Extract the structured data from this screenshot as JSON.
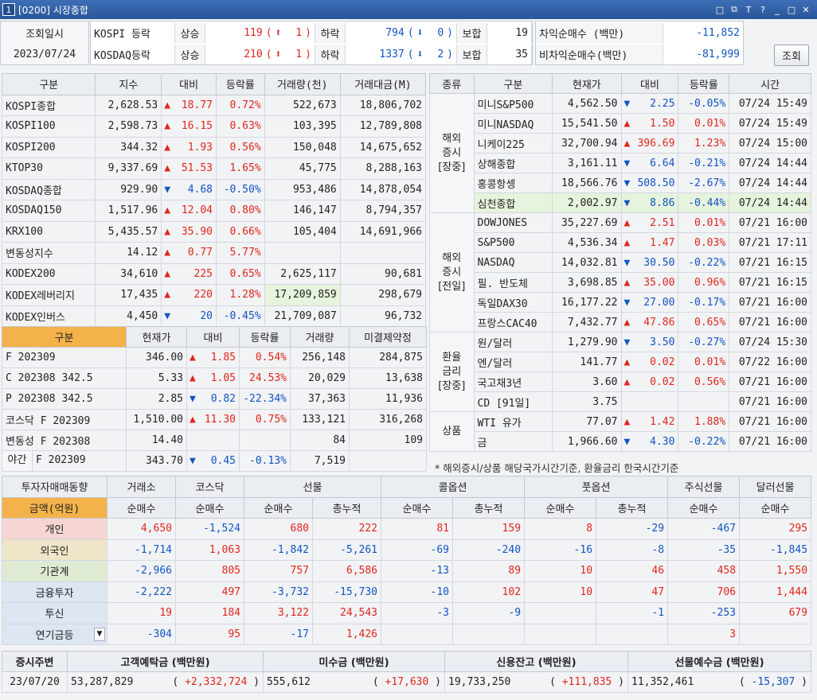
{
  "window": {
    "number": "1",
    "title": "[0200] 시장종합",
    "controls": [
      "□",
      "⧉",
      "T",
      "?",
      "_",
      "□",
      "✕"
    ]
  },
  "query": {
    "date_label": "조회일시",
    "date": "2023/07/24",
    "button": "조회"
  },
  "breadth": [
    {
      "market": "KOSPI 등락",
      "up_label": "상승",
      "up": "119",
      "up_arrow": "⬆",
      "up_limit": "1",
      "down_label": "하락",
      "down": "794",
      "down_arrow": "⬇",
      "down_limit": "0",
      "flat_label": "보합",
      "flat": "19"
    },
    {
      "market": "KOSDAQ등락",
      "up_label": "상승",
      "up": "210",
      "up_arrow": "⬆",
      "up_limit": "1",
      "down_label": "하락",
      "down": "1337",
      "down_arrow": "⬇",
      "down_limit": "2",
      "flat_label": "보합",
      "flat": "35"
    }
  ],
  "program": [
    {
      "label": "차익순매수 (백만)",
      "value": "-11,852"
    },
    {
      "label": "비차익순매수(백만)",
      "value": "-81,999"
    }
  ],
  "index_table": {
    "headers": [
      "구분",
      "지수",
      "대비",
      "등락률",
      "거래량(천)",
      "거래대금(M)"
    ],
    "rows": [
      {
        "name": "KOSPI종합",
        "price": "2,628.53",
        "dir": "up",
        "chg": "18.77",
        "rate": "0.72%",
        "vol": "522,673",
        "amt": "18,806,702"
      },
      {
        "name": "KOSPI100",
        "price": "2,598.73",
        "dir": "up",
        "chg": "16.15",
        "rate": "0.63%",
        "vol": "103,395",
        "amt": "12,789,808"
      },
      {
        "name": "KOSPI200",
        "price": "344.32",
        "dir": "up",
        "chg": "1.93",
        "rate": "0.56%",
        "vol": "150,048",
        "amt": "14,675,652"
      },
      {
        "name": "KTOP30",
        "price": "9,337.69",
        "dir": "up",
        "chg": "51.53",
        "rate": "1.65%",
        "vol": "45,775",
        "amt": "8,288,163"
      },
      {
        "name": "KOSDAQ종합",
        "price": "929.90",
        "dir": "dn",
        "chg": "4.68",
        "rate": "-0.50%",
        "vol": "953,486",
        "amt": "14,878,054"
      },
      {
        "name": "KOSDAQ150",
        "price": "1,517.96",
        "dir": "up",
        "chg": "12.04",
        "rate": "0.80%",
        "vol": "146,147",
        "amt": "8,794,357"
      },
      {
        "name": "KRX100",
        "price": "5,435.57",
        "dir": "up",
        "chg": "35.90",
        "rate": "0.66%",
        "vol": "105,404",
        "amt": "14,691,966"
      },
      {
        "name": "변동성지수",
        "price": "14.12",
        "dir": "up",
        "chg": "0.77",
        "rate": "5.77%",
        "vol": "",
        "amt": ""
      },
      {
        "name": "KODEX200",
        "price": "34,610",
        "dir": "up",
        "chg": "225",
        "rate": "0.65%",
        "vol": "2,625,117",
        "amt": "90,681"
      },
      {
        "name": "KODEX레버리지",
        "price": "17,435",
        "dir": "up",
        "chg": "220",
        "rate": "1.28%",
        "vol": "17,209,859",
        "amt": "298,679"
      },
      {
        "name": "KODEX인버스",
        "price": "4,450",
        "dir": "dn",
        "chg": "20",
        "rate": "-0.45%",
        "vol": "21,709,087",
        "amt": "96,732"
      }
    ]
  },
  "futures_table": {
    "headers": [
      "구분",
      "현재가",
      "대비",
      "등락률",
      "거래량",
      "미결제약정"
    ],
    "rows": [
      {
        "name": "F 202309",
        "price": "346.00",
        "dir": "up",
        "chg": "1.85",
        "rate": "0.54%",
        "vol": "256,148",
        "oi": "284,875"
      },
      {
        "name": "C 202308 342.5",
        "price": "5.33",
        "dir": "up",
        "chg": "1.05",
        "rate": "24.53%",
        "vol": "20,029",
        "oi": "13,638"
      },
      {
        "name": "P 202308 342.5",
        "price": "2.85",
        "dir": "dn",
        "chg": "0.82",
        "rate": "-22.34%",
        "vol": "37,363",
        "oi": "11,936"
      },
      {
        "name": "코스닥 F 202309",
        "price": "1,510.00",
        "dir": "up",
        "chg": "11.30",
        "rate": "0.75%",
        "vol": "133,121",
        "oi": "316,268"
      },
      {
        "name": "변동성 F 202308",
        "price": "14.40",
        "dir": "",
        "chg": "",
        "rate": "",
        "vol": "84",
        "oi": "109"
      }
    ],
    "night": {
      "tag": "야간",
      "name": "F 202309",
      "price": "343.70",
      "dir": "dn",
      "chg": "0.45",
      "rate": "-0.13%",
      "vol": "7,519",
      "oi": ""
    }
  },
  "global_table": {
    "headers": [
      "종류",
      "구분",
      "현재가",
      "대비",
      "등락률",
      "시간"
    ],
    "groups": [
      {
        "label": "해외\n증시\n[장중]",
        "rows": [
          {
            "name": "미니S&P500",
            "price": "4,562.50",
            "dir": "dn",
            "chg": "2.25",
            "rate": "-0.05%",
            "time": "07/24 15:49"
          },
          {
            "name": "미니NASDAQ",
            "price": "15,541.50",
            "dir": "up",
            "chg": "1.50",
            "rate": "0.01%",
            "time": "07/24 15:49"
          },
          {
            "name": "니케이225",
            "price": "32,700.94",
            "dir": "up",
            "chg": "396.69",
            "rate": "1.23%",
            "time": "07/24 15:00"
          },
          {
            "name": "상해종합",
            "price": "3,161.11",
            "dir": "dn",
            "chg": "6.64",
            "rate": "-0.21%",
            "time": "07/24 14:44"
          },
          {
            "name": "홍콩항셍",
            "price": "18,566.76",
            "dir": "dn",
            "chg": "508.50",
            "rate": "-2.67%",
            "time": "07/24 14:44"
          },
          {
            "name": "심천종합",
            "price": "2,002.97",
            "dir": "dn",
            "chg": "8.86",
            "rate": "-0.44%",
            "time": "07/24 14:44",
            "hl": true
          }
        ]
      },
      {
        "label": "해외\n증시\n[전일]",
        "rows": [
          {
            "name": "DOWJONES",
            "price": "35,227.69",
            "dir": "up",
            "chg": "2.51",
            "rate": "0.01%",
            "time": "07/21 16:00"
          },
          {
            "name": "S&P500",
            "price": "4,536.34",
            "dir": "up",
            "chg": "1.47",
            "rate": "0.03%",
            "time": "07/21 17:11"
          },
          {
            "name": "NASDAQ",
            "price": "14,032.81",
            "dir": "dn",
            "chg": "30.50",
            "rate": "-0.22%",
            "time": "07/21 16:15"
          },
          {
            "name": "필. 반도체",
            "price": "3,698.85",
            "dir": "up",
            "chg": "35.00",
            "rate": "0.96%",
            "time": "07/21 16:15"
          },
          {
            "name": "독일DAX30",
            "price": "16,177.22",
            "dir": "dn",
            "chg": "27.00",
            "rate": "-0.17%",
            "time": "07/21 16:00"
          },
          {
            "name": "프랑스CAC40",
            "price": "7,432.77",
            "dir": "up",
            "chg": "47.86",
            "rate": "0.65%",
            "time": "07/21 16:00"
          }
        ]
      },
      {
        "label": "환율\n금리\n[장중]",
        "rows": [
          {
            "name": "원/달러",
            "price": "1,279.90",
            "dir": "dn",
            "chg": "3.50",
            "rate": "-0.27%",
            "time": "07/24 15:30"
          },
          {
            "name": "엔/달러",
            "price": "141.77",
            "dir": "up",
            "chg": "0.02",
            "rate": "0.01%",
            "time": "07/22 16:00"
          },
          {
            "name": "국고채3년",
            "price": "3.60",
            "dir": "up",
            "chg": "0.02",
            "rate": "0.56%",
            "time": "07/21 16:00"
          },
          {
            "name": "CD [91일]",
            "price": "3.75",
            "dir": "",
            "chg": "",
            "rate": "",
            "time": "07/21 16:00"
          }
        ]
      },
      {
        "label": "상품",
        "rows": [
          {
            "name": "WTI 유가",
            "price": "77.07",
            "dir": "up",
            "chg": "1.42",
            "rate": "1.88%",
            "time": "07/21 16:00"
          },
          {
            "name": "금",
            "price": "1,966.60",
            "dir": "dn",
            "chg": "4.30",
            "rate": "-0.22%",
            "time": "07/21 16:00"
          }
        ]
      }
    ],
    "note": "* 해외증시/상품 해당국가시간기준, 환율금리 한국시간기준"
  },
  "investor_table": {
    "title": "투자자매매동향",
    "unit": "금액(억원)",
    "groups": [
      "거래소",
      "코스닥",
      "선물",
      "콜옵션",
      "풋옵션",
      "주식선물",
      "달러선물"
    ],
    "subheaders": [
      "순매수",
      "순매수",
      "순매수",
      "총누적",
      "순매수",
      "총누적",
      "순매수",
      "총누적",
      "순매수",
      "순매수"
    ],
    "rows": [
      {
        "name": "개인",
        "bg": "#f6d6d3",
        "vals": [
          "4,650",
          "-1,524",
          "680",
          "222",
          "81",
          "159",
          "8",
          "-29",
          "-467",
          "295"
        ]
      },
      {
        "name": "외국인",
        "bg": "#efe6c9",
        "vals": [
          "-1,714",
          "1,063",
          "-1,842",
          "-5,261",
          "-69",
          "-240",
          "-16",
          "-8",
          "-35",
          "-1,845"
        ]
      },
      {
        "name": "기관계",
        "bg": "#dfead2",
        "vals": [
          "-2,966",
          "805",
          "757",
          "6,586",
          "-13",
          "89",
          "10",
          "46",
          "458",
          "1,550"
        ]
      },
      {
        "name": "금융투자",
        "bg": "#dde6f2",
        "vals": [
          "-2,222",
          "497",
          "-3,732",
          "-15,730",
          "-10",
          "102",
          "10",
          "47",
          "706",
          "1,444"
        ]
      },
      {
        "name": "투신",
        "bg": "#dde6f2",
        "vals": [
          "19",
          "184",
          "3,122",
          "24,543",
          "-3",
          "-9",
          "",
          "-1",
          "-253",
          "679"
        ]
      },
      {
        "name": "연기금등",
        "bg": "#dde6f2",
        "dropdown": true,
        "vals": [
          "-304",
          "95",
          "-17",
          "1,426",
          "",
          "",
          "",
          "",
          "3",
          ""
        ]
      }
    ]
  },
  "deposits": {
    "headers": [
      "증시주변",
      "고객예탁금 (백만원)",
      "미수금 (백만원)",
      "신용잔고 (백만원)",
      "선물예수금 (백만원)"
    ],
    "date": "23/07/20",
    "items": [
      {
        "value": "53,287,829",
        "chg": "+2,332,724",
        "dir": "up"
      },
      {
        "value": "555,612",
        "chg": "+17,630",
        "dir": "up"
      },
      {
        "value": "19,733,250",
        "chg": "+111,835",
        "dir": "up"
      },
      {
        "value": "11,352,461",
        "chg": "-15,307",
        "dir": "dn"
      }
    ]
  },
  "colors": {
    "up": "#e0261d",
    "down": "#1254c4",
    "header": "#eaedf2",
    "futures_header": "#f4b24a",
    "highlight": "#e6f3dd"
  }
}
